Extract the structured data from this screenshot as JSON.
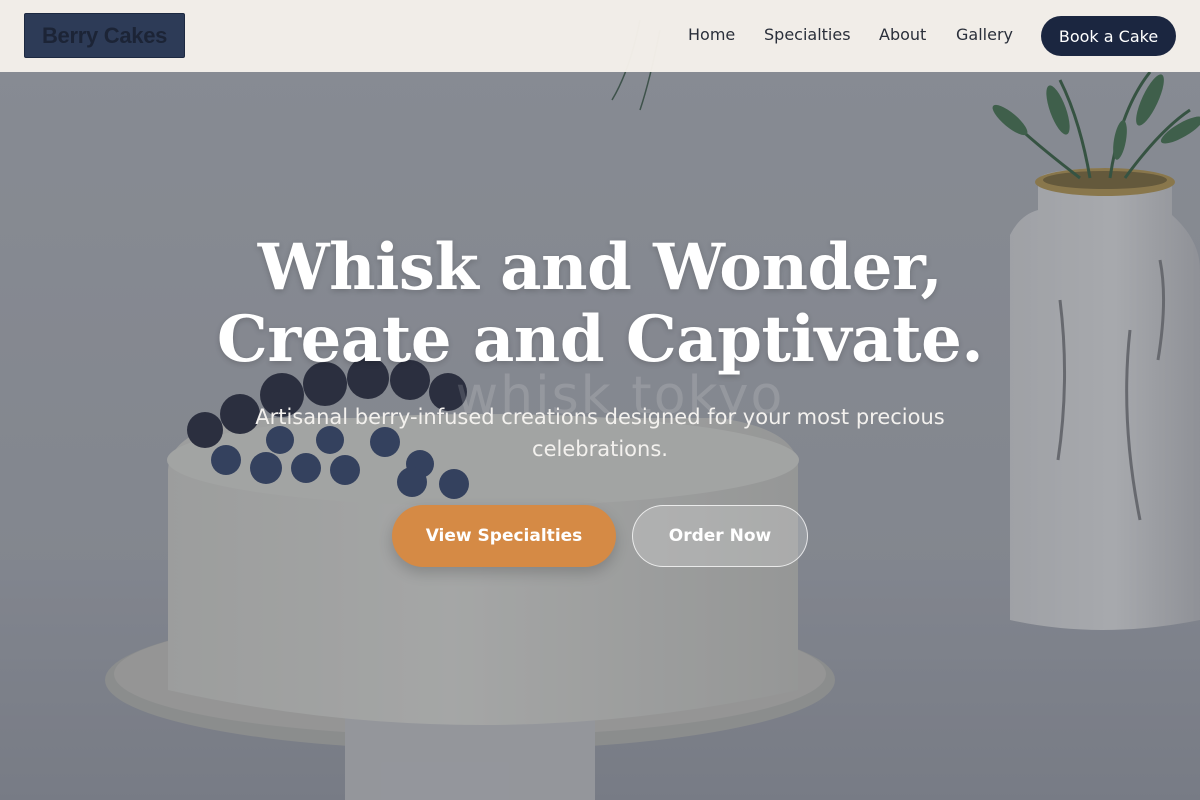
{
  "brand": {
    "name": "Berry Cakes"
  },
  "nav": {
    "links": [
      {
        "label": "Home"
      },
      {
        "label": "Specialties"
      },
      {
        "label": "About"
      },
      {
        "label": "Gallery"
      }
    ],
    "cta_label": "Book a Cake"
  },
  "hero": {
    "headline_line1": "Whisk and Wonder,",
    "headline_line2": "Create and Captivate.",
    "subtitle": "Artisanal berry-infused creations designed for your most precious celebrations.",
    "primary_button": "View Specialties",
    "secondary_button": "Order Now",
    "watermark": "whisk tokyo",
    "background_image": "frosted cake with blackberries and blueberries beside a white vase with green stems"
  },
  "colors": {
    "nav_background": "#f5f1ea",
    "brand_badge": "#2d3b57",
    "cta_dark": "#1b2640",
    "accent_orange": "#d58a45",
    "headline_text": "#ffffff"
  }
}
